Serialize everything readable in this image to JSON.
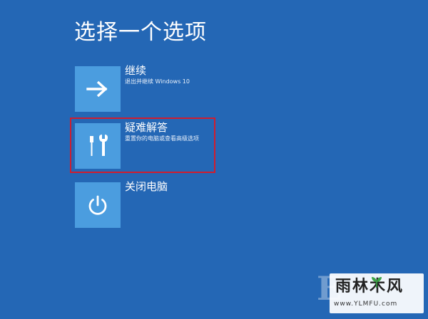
{
  "screen": {
    "title": "选择一个选项"
  },
  "options": [
    {
      "title": "继续",
      "subtitle": "退出并继续 Windows 10",
      "icon": "arrow-right-icon"
    },
    {
      "title": "疑难解答",
      "subtitle": "重置你的电脑或查看高级选项",
      "icon": "tools-icon"
    },
    {
      "title": "关闭电脑",
      "subtitle": "",
      "icon": "power-icon"
    }
  ],
  "watermark": {
    "brand": "雨林木风",
    "url": "www.YLMFU.com"
  },
  "colors": {
    "background": "#2467b5",
    "tile": "#4b9ddf",
    "highlight": "#d01d2e"
  }
}
